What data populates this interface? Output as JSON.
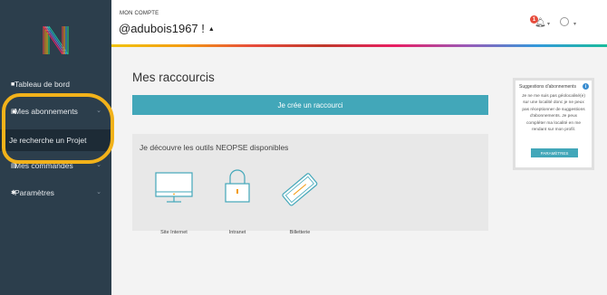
{
  "sidebar": {
    "items": [
      {
        "label": "Tableau de bord",
        "icon": "dashboard-icon"
      },
      {
        "label": "Mes abonnements",
        "icon": "subscriptions-icon"
      },
      {
        "label": "Je recherche un Projet"
      },
      {
        "label": "Mes commandes",
        "icon": "orders-icon"
      },
      {
        "label": "Paramètres",
        "icon": "gear-icon"
      }
    ]
  },
  "header": {
    "caption": "MON COMPTE",
    "username": "@adubois1967 !",
    "notification_count": "1"
  },
  "main": {
    "title": "Mes raccourcis",
    "cta_label": "Je crée un raccourci",
    "tools_title": "Je découvre les outils NEOPSE disponibles",
    "tools": [
      {
        "label": "Site Internet",
        "icon": "monitor-icon"
      },
      {
        "label": "Intranet",
        "icon": "lock-icon"
      },
      {
        "label": "Billetterie",
        "icon": "ticket-icon"
      }
    ]
  },
  "suggestions": {
    "title": "Suggestions d'abonnements",
    "text": "Je ne me suis pas géolocalisé(e) sur une localité donc je ne peux pas réceptionner de suggestions d'abonnements. Je peux compléter ma localité en me rendant sur mon profil.",
    "button": "PARAMÈTRES"
  },
  "colors": {
    "sidebar_bg": "#2c3e4c",
    "accent": "#42a7b9",
    "highlight": "#f2b21a",
    "badge": "#e74c3c"
  }
}
